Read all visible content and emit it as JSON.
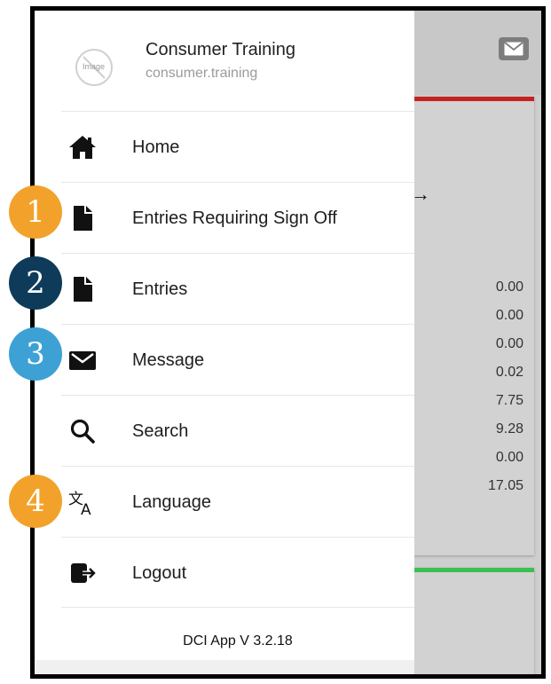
{
  "colors": {
    "badge_orange": "#f2a22a",
    "badge_navy": "#0f3b5a",
    "badge_blue": "#3ea1d6",
    "card_top_red": "#c42222",
    "card_top_green": "#3cbf4f"
  },
  "background": {
    "mail_icon": "envelope-icon",
    "arrow": "→",
    "values": [
      "0.00",
      "0.00",
      "0.00",
      "0.02",
      "7.75",
      "9.28",
      "0.00",
      "17.05"
    ]
  },
  "drawer": {
    "avatar_placeholder": "Image",
    "user_name": "Consumer Training",
    "username": "consumer.training",
    "menu": [
      {
        "label": "Home",
        "icon": "home-icon"
      },
      {
        "label": "Entries Requiring Sign Off",
        "icon": "document-icon"
      },
      {
        "label": "Entries",
        "icon": "document-icon"
      },
      {
        "label": "Message",
        "icon": "envelope-icon"
      },
      {
        "label": "Search",
        "icon": "search-icon"
      },
      {
        "label": "Language",
        "icon": "translate-icon"
      },
      {
        "label": "Logout",
        "icon": "logout-icon"
      }
    ],
    "version": "DCI App V 3.2.18"
  },
  "badges": [
    "1",
    "2",
    "3",
    "4"
  ]
}
